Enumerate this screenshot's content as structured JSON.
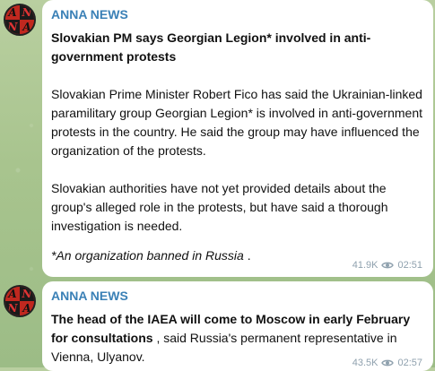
{
  "colors": {
    "channel": "#3a80b6",
    "meta": "#8fa1ae",
    "bubble": "#ffffff",
    "background": "#a8c48e"
  },
  "avatar_icon": "anna-news-logo",
  "messages": [
    {
      "channel": "ANNA NEWS",
      "avatar_letters": [
        "A",
        "N",
        "N",
        "A"
      ],
      "headline": "Slovakian PM says Georgian Legion* involved in anti-government protests",
      "paragraphs": [
        "Slovakian Prime Minister Robert Fico has said the Ukrainian-linked paramilitary group Georgian Legion* is involved in anti-government protests in the country. He said the group may have influenced the organization of the protests.",
        "Slovakian authorities have not yet provided details about the group's alleged role in the protests, but have said a thorough investigation is needed."
      ],
      "note": "*An organization banned in Russia",
      "note_suffix": " .",
      "views": "41.9K",
      "time": "02:51"
    },
    {
      "channel": "ANNA NEWS",
      "avatar_letters": [
        "A",
        "N",
        "N",
        "A"
      ],
      "bold_text": "The head of the IAEA will come to Moscow in early February for consultations",
      "text": " , said Russia's permanent representative in Vienna, Ulyanov.",
      "views": "43.5K",
      "time": "02:57"
    }
  ]
}
